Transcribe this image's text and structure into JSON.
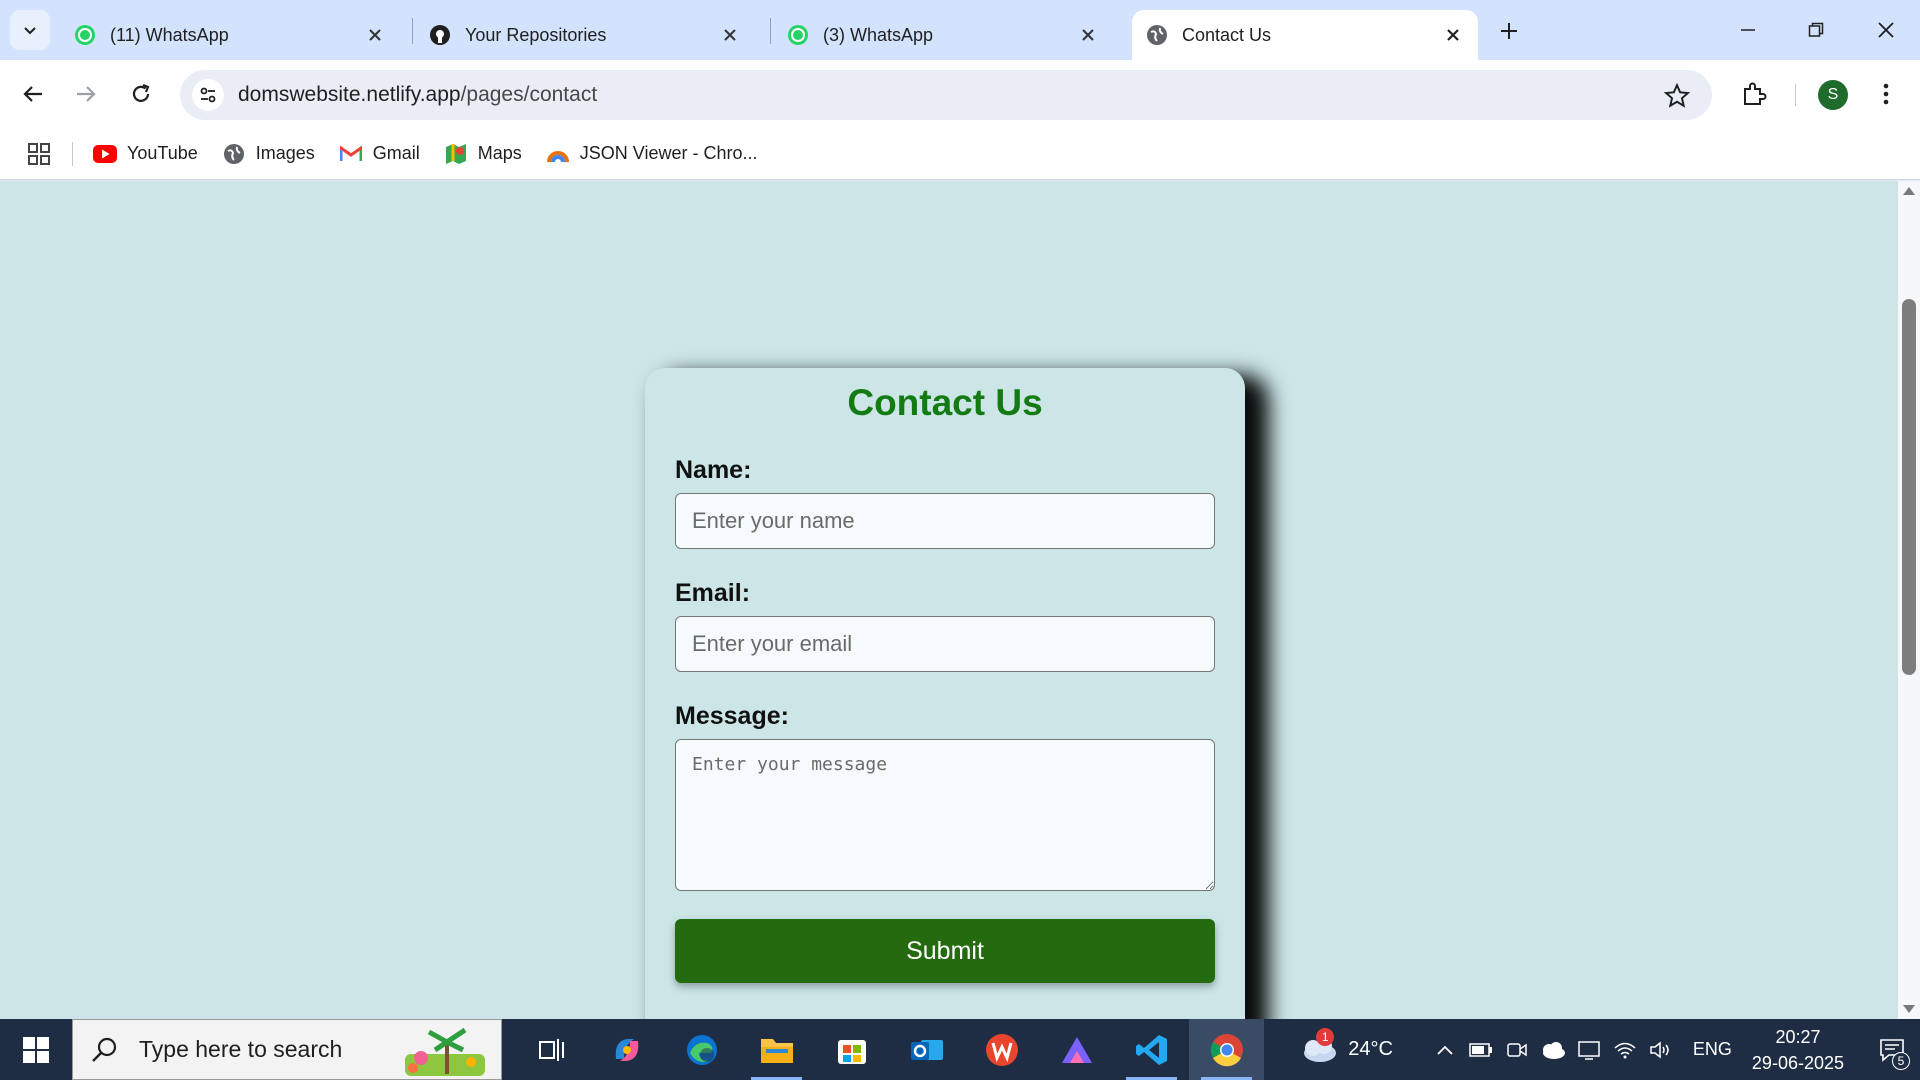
{
  "browser": {
    "tabs": [
      {
        "title": "(11) WhatsApp",
        "icon": "whatsapp-icon",
        "active": false
      },
      {
        "title": "Your Repositories",
        "icon": "github-icon",
        "active": false
      },
      {
        "title": "(3) WhatsApp",
        "icon": "whatsapp-icon",
        "active": false
      },
      {
        "title": "Contact Us",
        "icon": "globe-icon",
        "active": true
      }
    ],
    "url_host": "domswebsite.netlify.app",
    "url_path": "/pages/contact",
    "profile_initial": "S",
    "bookmarks": [
      {
        "label": "YouTube",
        "icon": "youtube-icon"
      },
      {
        "label": "Images",
        "icon": "globe-icon"
      },
      {
        "label": "Gmail",
        "icon": "gmail-icon"
      },
      {
        "label": "Maps",
        "icon": "maps-icon"
      },
      {
        "label": "JSON Viewer - Chro...",
        "icon": "json-viewer-icon"
      }
    ]
  },
  "page": {
    "heading": "Contact Us",
    "name_label": "Name:",
    "name_placeholder": "Enter your name",
    "email_label": "Email:",
    "email_placeholder": "Enter your email",
    "message_label": "Message:",
    "message_placeholder": "Enter your message",
    "submit_label": "Submit"
  },
  "taskbar": {
    "search_placeholder": "Type here to search",
    "weather_temp": "24°C",
    "weather_badge": "1",
    "language": "ENG",
    "time": "20:27",
    "date": "29-06-2025",
    "notification_count": "5"
  },
  "colors": {
    "page_background": "#cce6e8",
    "heading": "#137b12",
    "submit_button": "#236b0e",
    "tab_strip": "#d3e3fd"
  }
}
